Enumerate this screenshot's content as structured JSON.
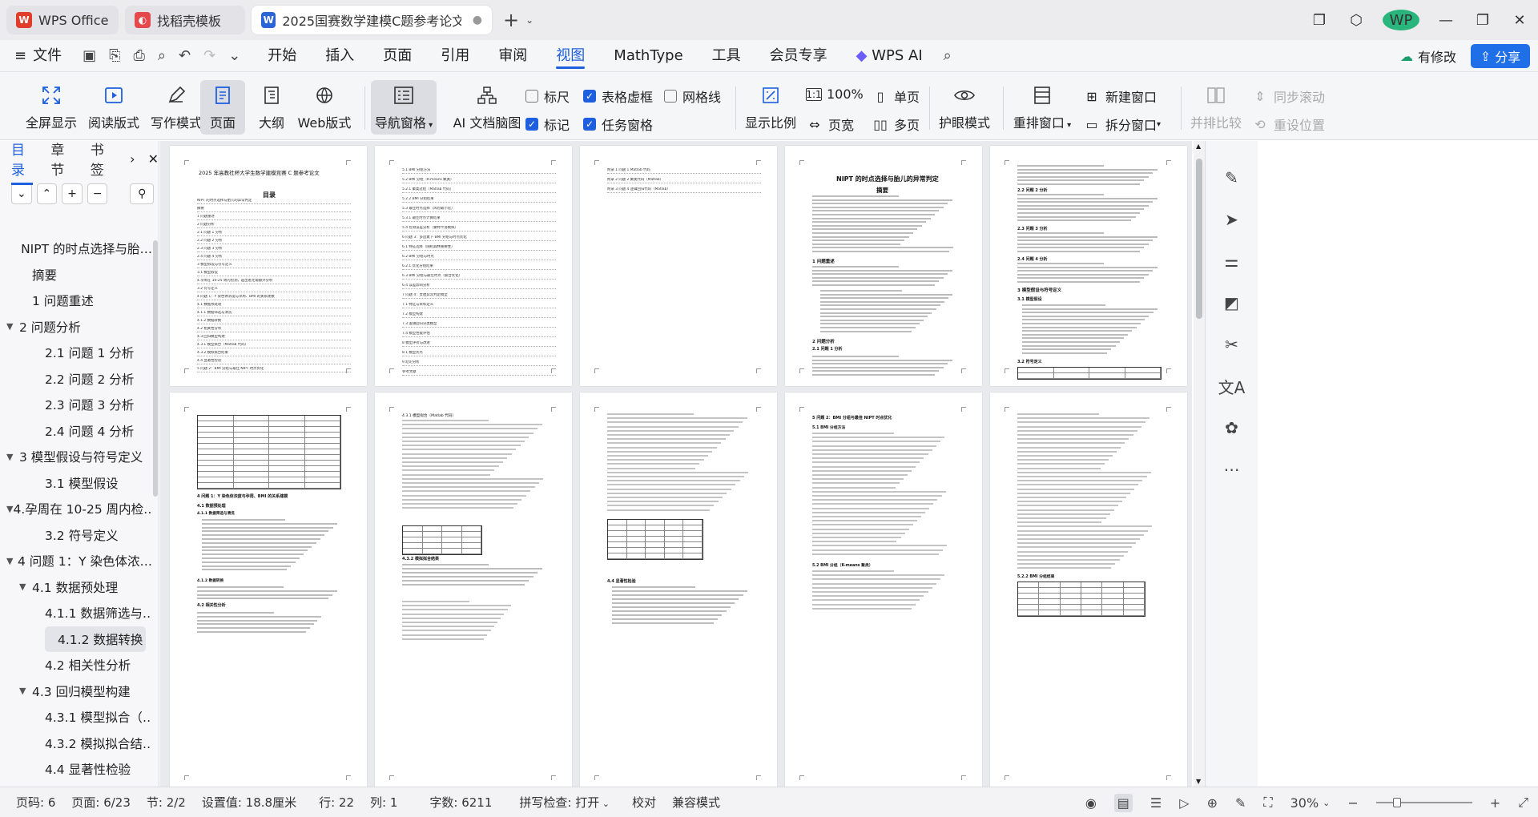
{
  "tabs": [
    {
      "label": "WPS Office",
      "icon": "wps-logo-icon",
      "color": "#e23c2b"
    },
    {
      "label": "找稻壳模板",
      "icon": "docer-icon",
      "color": "#e5484d"
    },
    {
      "label": "2025国赛数学建模C题参考论文.d",
      "icon": "word-doc-icon",
      "color": "#2b64d6"
    }
  ],
  "menu": {
    "file": "文件",
    "items": [
      "开始",
      "插入",
      "页面",
      "引用",
      "审阅",
      "视图",
      "MathType",
      "工具",
      "会员专享",
      "WPS AI"
    ],
    "active": "视图",
    "edit_btn": "有修改",
    "share_btn": "分享"
  },
  "ribbon": {
    "fullscreen": "全屏显示",
    "reading": "阅读版式",
    "writing": "写作模式",
    "page": "页面",
    "outline": "大纲",
    "web": "Web版式",
    "nav_pane": "导航窗格",
    "ai_map": "AI 文档脑图",
    "ruler": "标尺",
    "table_grid": "表格虚框",
    "gridlines": "网格线",
    "mark": "标记",
    "task_pane": "任务窗格",
    "zoom": "显示比例",
    "zoom100": "100%",
    "page_width": "页宽",
    "single_page": "单页",
    "multi_page": "多页",
    "eye_mode": "护眼模式",
    "rearrange": "重排窗口",
    "new_window": "新建窗口",
    "split_window": "拆分窗口",
    "side_by_side": "并排比较",
    "sync_scroll": "同步滚动",
    "reset_pos": "重设位置"
  },
  "sidebar": {
    "tabs": [
      "目录",
      "章节",
      "书签"
    ],
    "toc": [
      {
        "label": "NIPT 的时点选择与胎…",
        "level": 0
      },
      {
        "label": "摘要",
        "level": 0
      },
      {
        "label": "1 问题重述",
        "level": 0
      },
      {
        "label": "2 问题分析",
        "level": 0,
        "expand": true
      },
      {
        "label": "2.1 问题 1 分析",
        "level": 1
      },
      {
        "label": "2.2 问题 2 分析",
        "level": 1
      },
      {
        "label": "2.3 问题 3 分析",
        "level": 1
      },
      {
        "label": "2.4 问题 4 分析",
        "level": 1
      },
      {
        "label": "3 模型假设与符号定义",
        "level": 0,
        "expand": true
      },
      {
        "label": "3.1 模型假设",
        "level": 1
      },
      {
        "label": "4.孕周在 10-25 周内检…",
        "level": 0,
        "expand": true
      },
      {
        "label": "3.2 符号定义",
        "level": 1
      },
      {
        "label": "4 问题 1：Y 染色体浓…",
        "level": 0,
        "expand": true
      },
      {
        "label": "4.1 数据预处理",
        "level": 1,
        "expand": true
      },
      {
        "label": "4.1.1 数据筛选与…",
        "level": 2
      },
      {
        "label": "4.1.2 数据转换",
        "level": 2,
        "selected": true
      },
      {
        "label": "4.2 相关性分析",
        "level": 1
      },
      {
        "label": "4.3 回归模型构建",
        "level": 1,
        "expand": true
      },
      {
        "label": "4.3.1 模型拟合（…",
        "level": 2
      },
      {
        "label": "4.3.2 模拟拟合结…",
        "level": 2
      },
      {
        "label": "4.4 显著性检验",
        "level": 1
      }
    ]
  },
  "pages": {
    "p1": {
      "header": "2025 年高教社杯大学生数学建模竞赛 C 题参考论文",
      "title": "目录",
      "lines": [
        "NIPT 的时点选择与胎儿的异常判定",
        "摘要",
        "1 问题重述",
        "2 问题分析",
        "2.1 问题 1 分析",
        "2.2 问题 2 分析",
        "2.3 问题 3 分析",
        "2.4 问题 4 分析",
        "3 模型假设与符号定义",
        "3.1 模型假设",
        "4.孕周在 10-25 周内检测，超出者无需额外分析",
        "3.2 符号定义",
        "4 问题 1：Y 染色体浓度与孕周、BMI 的关系建模",
        "4.1 数据预处理",
        "4.1.1 数据筛选与清洗",
        "4.1.2 数据转换",
        "4.2 相关性分析",
        "4.3 回归模型构建",
        "4.3.1 模型拟合（Matlab 代码）",
        "4.3.2 模拟拟合结果",
        "4.4 显著性检验",
        "5 问题 2：BMI 分组与最佳 NIPT 时点优化"
      ]
    },
    "p2": {
      "lines": [
        "5.1 BMI 分组方法",
        "5.2 BMI 分组（K-means 聚类）",
        "5.2.1 聚类过程（Matlab 代码）",
        "5.2.2 BMI 分组结果",
        "5.3 最佳时点选择（风险最小化）",
        "5.3.1 最佳时点计算结果",
        "5.4 检测误差分析（蒙特卡洛模拟）",
        "6 问题 3：多因素下 BMI 分组与时点优化",
        "6.1 特征选择（随机森林重要性）",
        "6.2 BMI 分组与时点",
        "6.2.1 优化分组结果",
        "6.3 BMI 分组与最佳时点（联合优化）",
        "6.4 误差影响分析",
        "7 问题 4：女胎异常判定模型",
        "7.1 特征与目标定义",
        "7.2 模型构建",
        "7.3 逻辑回归分类模型",
        "7.4 模型性能评估",
        "8 模型评价与改进",
        "8.1 模型优点",
        "9 结论分析",
        "参考文献"
      ]
    },
    "p3": {
      "lines": [
        "附录 1 问题 1 Matlab 代码",
        "附录 2 问题 2 聚类代码（Matlab）",
        "附录 3 问题 4 逻辑回归代码（Matlab）"
      ]
    },
    "p4": {
      "title": "NIPT 的时点选择与胎儿的异常判定",
      "abstract": "摘要",
      "sections": [
        "1 问题重述",
        "2 问题分析",
        "2.1 问题 1 分析"
      ]
    },
    "p5": {
      "sections": [
        "2.2 问题 2 分析",
        "2.3 问题 3 分析",
        "2.4 问题 4 分析",
        "3 模型假设与符号定义",
        "3.1 模型假设",
        "3.2 符号定义"
      ]
    },
    "p6": {
      "sections": [
        "4 问题 1：Y 染色体浓度与孕周、BMI 的关系建模",
        "4.1 数据预处理",
        "4.1.1 数据筛选与清洗",
        "4.1.2 数据转换",
        "4.2 相关性分析"
      ]
    },
    "p7": {
      "sections": [
        "4.3.1 模型拟合（Matlab 代码）",
        "4.3.2 模拟拟合结果"
      ]
    },
    "p8": {
      "sections": [
        "4.4 显著性检验"
      ]
    },
    "p9": {
      "sections": [
        "5 问题 2：BMI 分组与最佳 NIPT 时点优化",
        "5.1 BMI 分组方法",
        "5.2 BMI 分组（K-means 聚类）"
      ]
    },
    "p10": {
      "sections": [
        "5.2.2 BMI 分组结果"
      ]
    }
  },
  "status": {
    "page_code": "页码: 6",
    "page": "页面: 6/23",
    "section": "节: 2/2",
    "setting": "设置值: 18.8厘米",
    "row": "行: 22",
    "col": "列: 1",
    "words": "字数: 6211",
    "spell": "拼写检查: 打开",
    "proof": "校对",
    "compat": "兼容模式",
    "zoom": "30%"
  },
  "colors": {
    "accent": "#1e5fdf",
    "share": "#1e6fe8"
  }
}
